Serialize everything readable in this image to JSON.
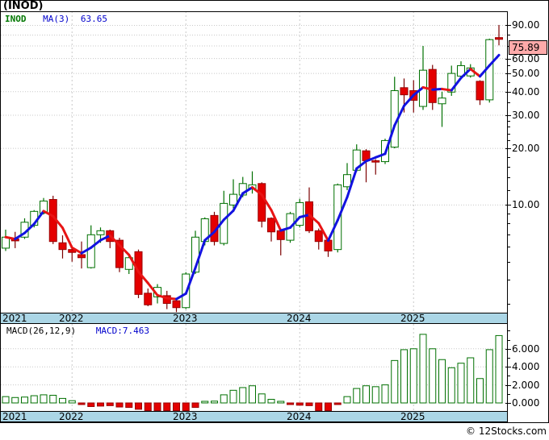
{
  "window": {
    "title": "(INOD)"
  },
  "legend": {
    "symbol": "INOD",
    "ma_label": "MA(3)",
    "ma_value": "63.65"
  },
  "price_label": "75.89",
  "copyright": "© 12Stocks.com",
  "colors": {
    "up": "#007000",
    "down_fill": "#e40000",
    "down_stroke": "#990000",
    "down_wick": "#7c0000",
    "ma_up": "#1212e0",
    "ma_down": "#e81414",
    "band": "#abd6e6",
    "grid": "#c8c8c8",
    "price_box_bg": "#ffaaaa",
    "legend_symbol": "#007700",
    "legend_blue": "#0000cc"
  },
  "price_axis": {
    "labels": [
      {
        "value": 90,
        "text": "90.00"
      },
      {
        "value": 60,
        "text": "60.00"
      },
      {
        "value": 50,
        "text": "50.00"
      },
      {
        "value": 40,
        "text": "40.00"
      },
      {
        "value": 30,
        "text": "30.00"
      },
      {
        "value": 20,
        "text": "20.00"
      },
      {
        "value": 10,
        "text": "10.00"
      }
    ],
    "minor_ticks": [
      80,
      70,
      55,
      45,
      35,
      28,
      26,
      24,
      22,
      18,
      16,
      14,
      12,
      9,
      8,
      7,
      6,
      5,
      4,
      3
    ],
    "gridlines": [
      90,
      80,
      70,
      60,
      50,
      40,
      30,
      20,
      10
    ]
  },
  "macd_panel": {
    "params_label": "MACD(26,12,9)",
    "value_label": "MACD:7.463",
    "axis_labels": [
      {
        "value": 6,
        "text": "6.000"
      },
      {
        "value": 4,
        "text": "4.000"
      },
      {
        "value": 2,
        "text": "2.000"
      },
      {
        "value": 0,
        "text": "0.000"
      }
    ],
    "minor_ticks": [
      8,
      7,
      5,
      3,
      1
    ],
    "gridlines": [
      6,
      4,
      2,
      0
    ]
  },
  "x_axis": {
    "years": [
      "2021",
      "2022",
      "2023",
      "2024",
      "2025"
    ]
  },
  "chart_data": {
    "type": "candlestick",
    "symbol": "INOD",
    "interval": "monthly",
    "log_scale": true,
    "ylim": [
      2.7,
      95
    ],
    "indicators": {
      "ma_period": 3,
      "ma_value": 63.65,
      "macd_params": "26,12,9",
      "macd_value": 7.463
    },
    "candles": [
      {
        "t": "2021-06",
        "o": 5.9,
        "h": 7.4,
        "l": 5.7,
        "c": 6.75
      },
      {
        "t": "2021-07",
        "o": 6.6,
        "h": 7.2,
        "l": 5.9,
        "c": 6.45
      },
      {
        "t": "2021-08",
        "o": 6.75,
        "h": 8.5,
        "l": 6.6,
        "c": 8.1
      },
      {
        "t": "2021-09",
        "o": 7.8,
        "h": 9.4,
        "l": 7.6,
        "c": 9.25
      },
      {
        "t": "2021-10",
        "o": 9.05,
        "h": 10.9,
        "l": 8.9,
        "c": 10.5
      },
      {
        "t": "2021-11",
        "o": 10.7,
        "h": 11.2,
        "l": 6.2,
        "c": 6.4
      },
      {
        "t": "2021-12",
        "o": 6.3,
        "h": 6.9,
        "l": 5.2,
        "c": 5.8
      },
      {
        "t": "2022-01",
        "o": 5.8,
        "h": 6.0,
        "l": 5.0,
        "c": 5.6
      },
      {
        "t": "2022-02",
        "o": 5.45,
        "h": 6.4,
        "l": 4.6,
        "c": 5.25
      },
      {
        "t": "2022-03",
        "o": 4.65,
        "h": 7.8,
        "l": 4.6,
        "c": 6.95
      },
      {
        "t": "2022-04",
        "o": 6.95,
        "h": 7.6,
        "l": 6.3,
        "c": 7.3
      },
      {
        "t": "2022-05",
        "o": 7.3,
        "h": 7.4,
        "l": 5.9,
        "c": 6.4
      },
      {
        "t": "2022-06",
        "o": 6.5,
        "h": 6.7,
        "l": 4.4,
        "c": 4.65
      },
      {
        "t": "2022-07",
        "o": 4.55,
        "h": 5.4,
        "l": 4.3,
        "c": 5.25
      },
      {
        "t": "2022-08",
        "o": 5.65,
        "h": 5.8,
        "l": 3.2,
        "c": 3.35
      },
      {
        "t": "2022-09",
        "o": 3.4,
        "h": 3.6,
        "l": 2.9,
        "c": 2.95
      },
      {
        "t": "2022-10",
        "o": 3.25,
        "h": 3.8,
        "l": 3.0,
        "c": 3.65
      },
      {
        "t": "2022-11",
        "o": 3.3,
        "h": 3.5,
        "l": 2.8,
        "c": 3.0
      },
      {
        "t": "2022-12",
        "o": 3.1,
        "h": 3.2,
        "l": 2.7,
        "c": 2.85
      },
      {
        "t": "2023-01",
        "o": 2.85,
        "h": 4.4,
        "l": 2.8,
        "c": 4.3
      },
      {
        "t": "2023-02",
        "o": 4.4,
        "h": 7.3,
        "l": 4.3,
        "c": 6.75
      },
      {
        "t": "2023-03",
        "o": 6.4,
        "h": 8.6,
        "l": 6.1,
        "c": 8.45
      },
      {
        "t": "2023-04",
        "o": 8.8,
        "h": 9.2,
        "l": 6.1,
        "c": 6.4
      },
      {
        "t": "2023-05",
        "o": 6.25,
        "h": 11.9,
        "l": 6.1,
        "c": 10.2
      },
      {
        "t": "2023-06",
        "o": 10.0,
        "h": 13.7,
        "l": 9.6,
        "c": 11.4
      },
      {
        "t": "2023-07",
        "o": 11.3,
        "h": 14.1,
        "l": 11.0,
        "c": 13.0
      },
      {
        "t": "2023-08",
        "o": 12.2,
        "h": 15.1,
        "l": 11.5,
        "c": 12.8
      },
      {
        "t": "2023-09",
        "o": 13.0,
        "h": 13.2,
        "l": 7.6,
        "c": 8.2
      },
      {
        "t": "2023-10",
        "o": 8.5,
        "h": 8.6,
        "l": 6.4,
        "c": 7.2
      },
      {
        "t": "2023-11",
        "o": 7.3,
        "h": 7.5,
        "l": 5.4,
        "c": 6.55
      },
      {
        "t": "2023-12",
        "o": 6.5,
        "h": 9.2,
        "l": 6.3,
        "c": 9.0
      },
      {
        "t": "2024-01",
        "o": 7.8,
        "h": 10.8,
        "l": 7.6,
        "c": 10.3
      },
      {
        "t": "2024-02",
        "o": 10.4,
        "h": 12.4,
        "l": 7.1,
        "c": 7.3
      },
      {
        "t": "2024-03",
        "o": 7.3,
        "h": 7.5,
        "l": 5.8,
        "c": 6.4
      },
      {
        "t": "2024-04",
        "o": 6.5,
        "h": 6.6,
        "l": 5.3,
        "c": 5.7
      },
      {
        "t": "2024-05",
        "o": 5.8,
        "h": 13.0,
        "l": 5.6,
        "c": 12.8
      },
      {
        "t": "2024-06",
        "o": 12.5,
        "h": 16.7,
        "l": 12.0,
        "c": 14.5
      },
      {
        "t": "2024-07",
        "o": 15.3,
        "h": 21.0,
        "l": 15.0,
        "c": 19.6
      },
      {
        "t": "2024-08",
        "o": 19.4,
        "h": 19.8,
        "l": 13.2,
        "c": 17.2
      },
      {
        "t": "2024-09",
        "o": 17.2,
        "h": 17.5,
        "l": 14.5,
        "c": 16.9
      },
      {
        "t": "2024-10",
        "o": 17.0,
        "h": 22.5,
        "l": 16.5,
        "c": 22.0
      },
      {
        "t": "2024-11",
        "o": 20.3,
        "h": 48.0,
        "l": 20.0,
        "c": 40.5
      },
      {
        "t": "2024-12",
        "o": 42.0,
        "h": 47.0,
        "l": 31.0,
        "c": 38.5
      },
      {
        "t": "2025-01",
        "o": 40.5,
        "h": 46.0,
        "l": 31.0,
        "c": 36.0
      },
      {
        "t": "2025-02",
        "o": 33.4,
        "h": 70.0,
        "l": 32.0,
        "c": 52.0
      },
      {
        "t": "2025-03",
        "o": 52.5,
        "h": 55.5,
        "l": 32.0,
        "c": 35.0
      },
      {
        "t": "2025-04",
        "o": 34.5,
        "h": 40.0,
        "l": 26.0,
        "c": 37.0
      },
      {
        "t": "2025-05",
        "o": 39.8,
        "h": 55.0,
        "l": 38.0,
        "c": 50.0
      },
      {
        "t": "2025-06",
        "o": 48.4,
        "h": 58.0,
        "l": 47.0,
        "c": 55.0
      },
      {
        "t": "2025-07",
        "o": 48.5,
        "h": 56.0,
        "l": 47.5,
        "c": 53.5
      },
      {
        "t": "2025-08",
        "o": 45.4,
        "h": 46.0,
        "l": 34.0,
        "c": 36.2
      },
      {
        "t": "2025-09",
        "o": 36.2,
        "h": 76.5,
        "l": 35.0,
        "c": 75.6
      },
      {
        "t": "2025-10",
        "o": 77.5,
        "h": 90.5,
        "l": 70.5,
        "c": 75.89
      }
    ],
    "macd_histogram": [
      0.7,
      0.6,
      0.65,
      0.8,
      0.9,
      0.85,
      0.5,
      0.25,
      -0.15,
      -0.4,
      -0.35,
      -0.3,
      -0.45,
      -0.5,
      -0.7,
      -0.85,
      -1.0,
      -1.2,
      -1.3,
      -1.1,
      -0.5,
      0.15,
      0.2,
      0.9,
      1.4,
      1.7,
      1.9,
      1.0,
      0.4,
      0.1,
      -0.15,
      -0.25,
      -0.3,
      -1.0,
      -1.3,
      -0.15,
      0.7,
      1.6,
      1.9,
      1.8,
      2.0,
      4.7,
      5.9,
      6.0,
      7.6,
      6.0,
      4.8,
      3.9,
      4.4,
      5.0,
      2.7,
      5.9,
      7.463
    ]
  }
}
